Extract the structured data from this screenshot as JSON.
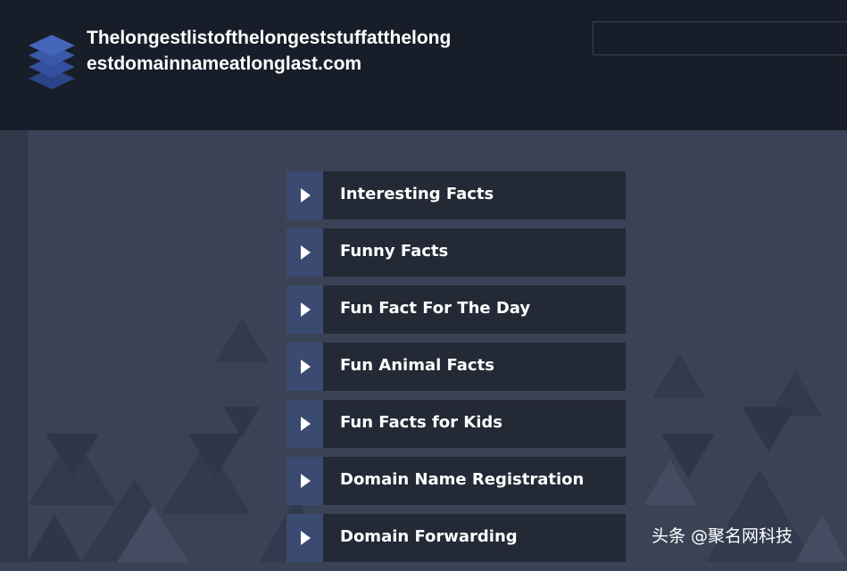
{
  "header": {
    "site_title": "Thelongestlistofthelongeststuffatthelongestdomainnameatlonglast.com",
    "search": {
      "value": "",
      "placeholder": ""
    },
    "logo_icon": "stacked-layers-icon"
  },
  "menu": {
    "items": [
      {
        "label": "Interesting Facts",
        "icon": "play-arrow-icon"
      },
      {
        "label": "Funny Facts",
        "icon": "play-arrow-icon"
      },
      {
        "label": "Fun Fact For The Day",
        "icon": "play-arrow-icon"
      },
      {
        "label": "Fun Animal Facts",
        "icon": "play-arrow-icon"
      },
      {
        "label": "Fun Facts for Kids",
        "icon": "play-arrow-icon"
      },
      {
        "label": "Domain Name Registration",
        "icon": "play-arrow-icon"
      },
      {
        "label": "Domain Forwarding",
        "icon": "play-arrow-icon"
      }
    ]
  },
  "watermark": "头条 @聚名网科技",
  "colors": {
    "header_bg": "#181e29",
    "page_bg": "#3a4356",
    "menu_item_bg": "#232935",
    "menu_arrow_bg": "#3b4a70",
    "logo_blue": "#3a5aa8"
  }
}
